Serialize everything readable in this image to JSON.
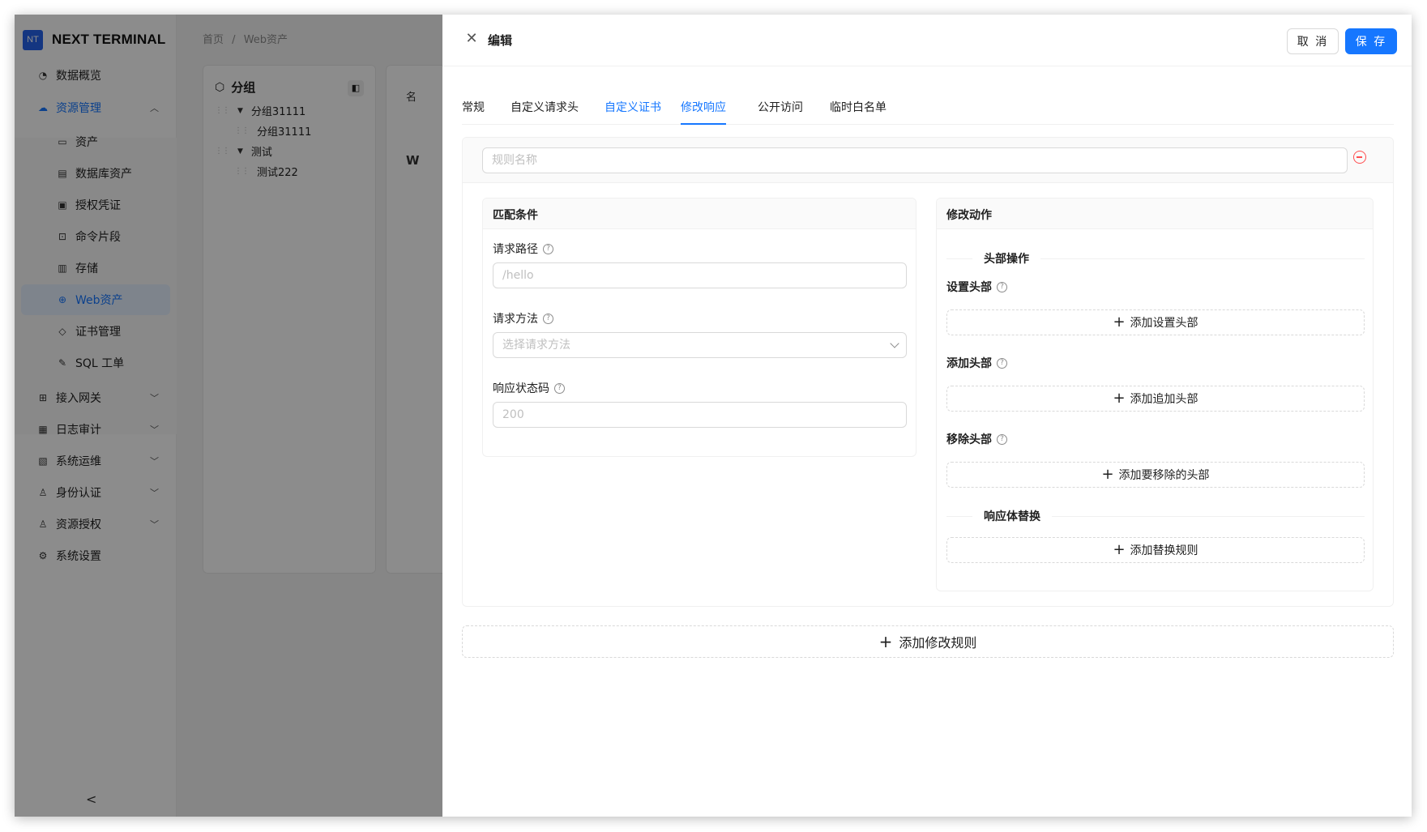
{
  "app": {
    "logo_badge": "NT",
    "logo_text": "NEXT TERMINAL"
  },
  "sidebar": {
    "items": [
      {
        "label": "数据概览",
        "icon": "dashboard-icon"
      },
      {
        "label": "资源管理",
        "icon": "cloud-icon"
      },
      {
        "label": "资产",
        "icon": "monitor-icon"
      },
      {
        "label": "数据库资产",
        "icon": "database-icon"
      },
      {
        "label": "授权凭证",
        "icon": "id-card-icon"
      },
      {
        "label": "命令片段",
        "icon": "terminal-icon"
      },
      {
        "label": "存储",
        "icon": "storage-icon"
      },
      {
        "label": "Web资产",
        "icon": "globe-icon"
      },
      {
        "label": "证书管理",
        "icon": "shield-icon"
      },
      {
        "label": "SQL 工单",
        "icon": "edit-icon"
      },
      {
        "label": "接入网关",
        "icon": "gateway-icon"
      },
      {
        "label": "日志审计",
        "icon": "audit-icon"
      },
      {
        "label": "系统运维",
        "icon": "ops-icon"
      },
      {
        "label": "身份认证",
        "icon": "user-icon"
      },
      {
        "label": "资源授权",
        "icon": "user-auth-icon"
      },
      {
        "label": "系统设置",
        "icon": "settings-icon"
      }
    ]
  },
  "breadcrumb": {
    "home": "首页",
    "separator": "/",
    "current": "Web资产"
  },
  "group_panel": {
    "title": "分组",
    "nodes": [
      {
        "label": "分组31111"
      },
      {
        "label": "分组31111"
      },
      {
        "label": "测试"
      },
      {
        "label": "测试222"
      }
    ]
  },
  "content_fragments": {
    "col1": "名",
    "col2": "W"
  },
  "drawer": {
    "title": "编辑",
    "cancel_label": "取 消",
    "save_label": "保 存",
    "tabs": [
      {
        "label": "常规"
      },
      {
        "label": "自定义请求头"
      },
      {
        "label": "自定义证书"
      },
      {
        "label": "修改响应"
      },
      {
        "label": "公开访问"
      },
      {
        "label": "临时白名单"
      }
    ],
    "active_tab": "修改响应",
    "rule": {
      "name_placeholder": "规则名称",
      "match": {
        "title": "匹配条件",
        "path_label": "请求路径",
        "path_placeholder": "/hello",
        "method_label": "请求方法",
        "method_placeholder": "选择请求方法",
        "status_label": "响应状态码",
        "status_placeholder": "200"
      },
      "action": {
        "title": "修改动作",
        "header_ops_divider": "头部操作",
        "set_header_label": "设置头部",
        "set_header_button": "添加设置头部",
        "add_header_label": "添加头部",
        "add_header_button": "添加追加头部",
        "remove_header_label": "移除头部",
        "remove_header_button": "添加要移除的头部",
        "body_divider": "响应体替换",
        "body_button": "添加替换规则"
      }
    },
    "add_rule_button": "添加修改规则"
  },
  "colors": {
    "primary": "#1677ff",
    "danger": "#ff4d4f",
    "mask": "rgba(0,0,0,0.45)"
  }
}
